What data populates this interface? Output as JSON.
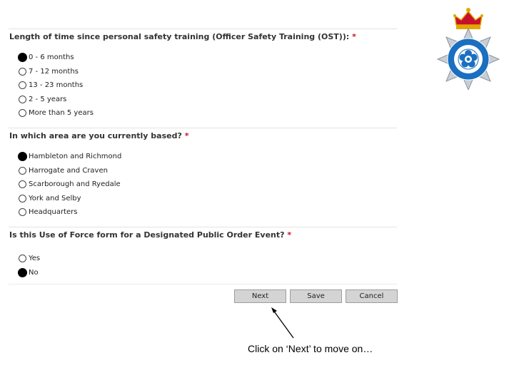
{
  "questions": [
    {
      "label": "Length of time since personal safety training (Officer Safety Training (OST)):",
      "required": "*",
      "options": [
        "0 - 6 months",
        "7 - 12 months",
        "13 - 23 months",
        "2 - 5 years",
        "More than 5 years"
      ],
      "selected": 0
    },
    {
      "label": "In which area are you currently based?",
      "required": "*",
      "options": [
        "Hambleton and Richmond",
        "Harrogate and Craven",
        "Scarborough and Ryedale",
        "York and Selby",
        "Headquarters"
      ],
      "selected": 0
    },
    {
      "label": "Is this Use of Force form for a Designated Public Order Event?",
      "required": "*",
      "options": [
        "Yes",
        "No"
      ],
      "selected": 1
    }
  ],
  "buttons": {
    "next": "Next",
    "save": "Save",
    "cancel": "Cancel"
  },
  "callout": "Click on ‘Next’ to move on…",
  "logo": {
    "icon": "police-crest-icon",
    "colors": {
      "blue": "#1a6fc0",
      "red": "#c8102e",
      "gold": "#e0a800",
      "silver": "#c9ced6"
    }
  }
}
